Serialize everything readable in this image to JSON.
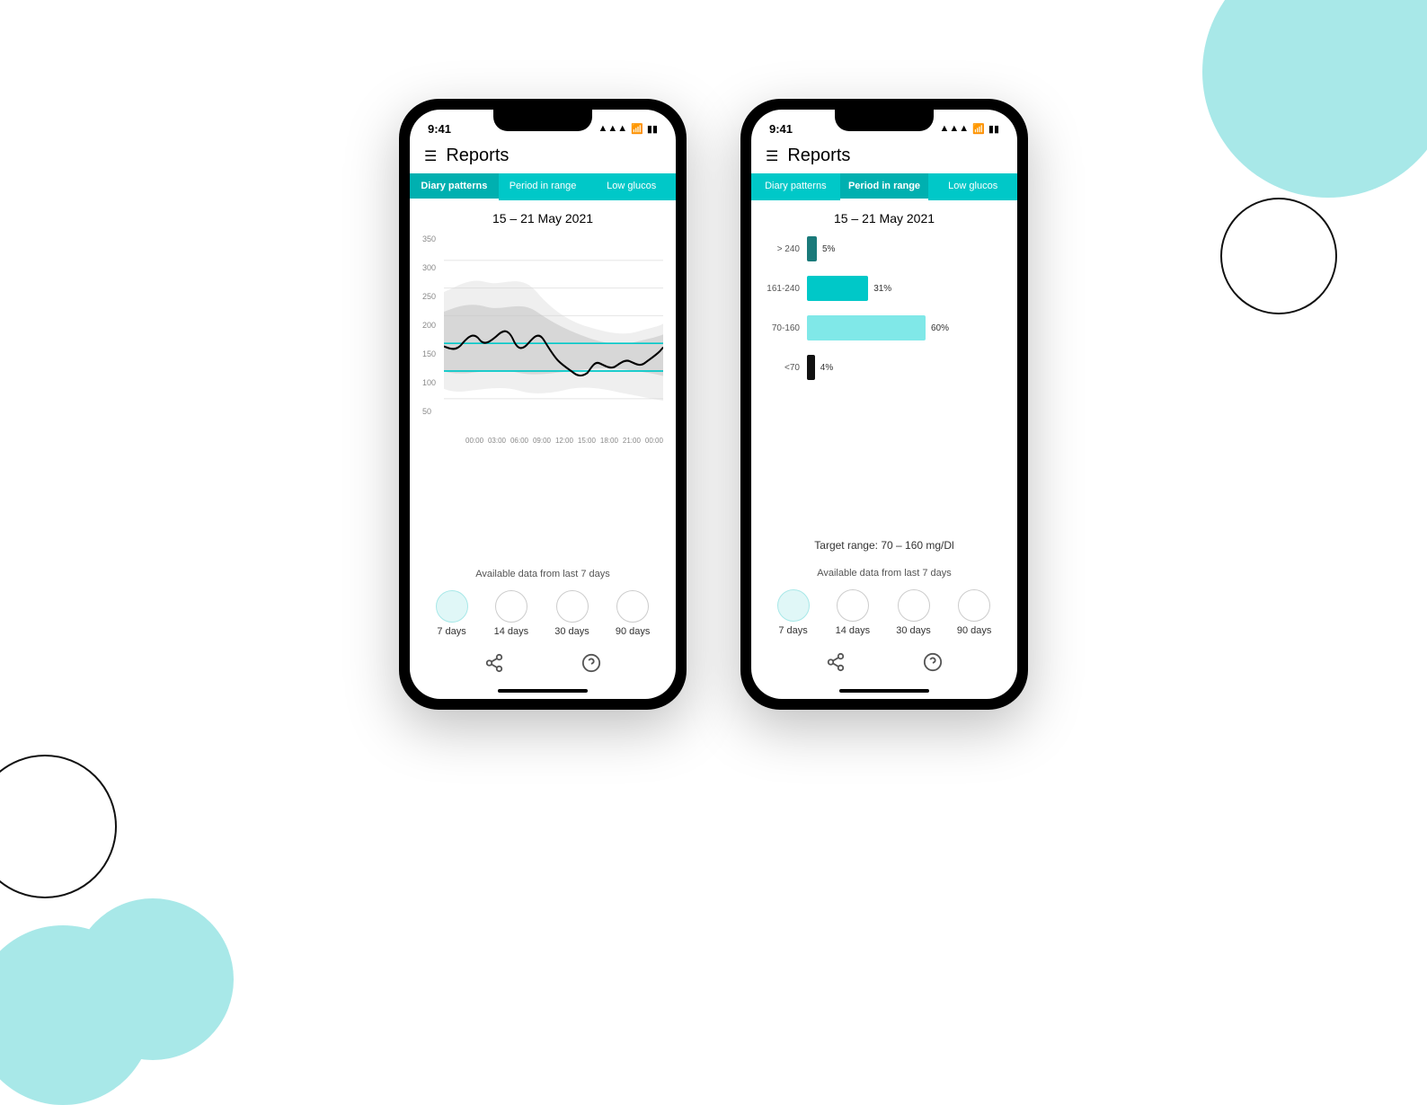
{
  "background": {
    "teal_color": "#a8e8e8",
    "accent_color": "#00c8c8"
  },
  "phone1": {
    "status_bar": {
      "time": "9:41",
      "signal": "▲▲▲",
      "wifi": "wifi",
      "battery": "battery"
    },
    "header": {
      "title": "Reports"
    },
    "tabs": [
      {
        "label": "Diary patterns",
        "active": true
      },
      {
        "label": "Period in range",
        "active": false
      },
      {
        "label": "Low glucos",
        "active": false
      }
    ],
    "date_range": "15 – 21 May 2021",
    "y_axis": [
      "350",
      "300",
      "250",
      "200",
      "150",
      "100",
      "50"
    ],
    "x_axis": [
      "00:00",
      "03:00",
      "06:00",
      "09:00",
      "12:00",
      "15:00",
      "18:00",
      "21:00",
      "00:00"
    ],
    "available_data_label": "Available data from last 7 days",
    "periods": [
      {
        "label": "7 days",
        "selected": true
      },
      {
        "label": "14 days",
        "selected": false
      },
      {
        "label": "30 days",
        "selected": false
      },
      {
        "label": "90 days",
        "selected": false
      }
    ],
    "share_icon": "⋰",
    "help_icon": "?"
  },
  "phone2": {
    "status_bar": {
      "time": "9:41",
      "signal": "▲▲▲",
      "wifi": "wifi",
      "battery": "battery"
    },
    "header": {
      "title": "Reports"
    },
    "tabs": [
      {
        "label": "Diary patterns",
        "active": false
      },
      {
        "label": "Period in range",
        "active": true
      },
      {
        "label": "Low glucos",
        "active": false
      }
    ],
    "date_range": "15 – 21 May 2021",
    "bars": [
      {
        "label": "> 240",
        "pct": "5%",
        "value": 5,
        "color": "#1a7a7a",
        "max": 100
      },
      {
        "label": "161-240",
        "pct": "31%",
        "value": 31,
        "color": "#00c8c8",
        "max": 100
      },
      {
        "label": "70-160",
        "pct": "60%",
        "value": 60,
        "color": "#80e8e8",
        "max": 100
      },
      {
        "label": "<70",
        "pct": "4%",
        "value": 4,
        "color": "#111111",
        "max": 100
      }
    ],
    "target_range": "Target range: 70 – 160 mg/Dl",
    "available_data_label": "Available data from last 7 days",
    "periods": [
      {
        "label": "7 days",
        "selected": true
      },
      {
        "label": "14 days",
        "selected": false
      },
      {
        "label": "30 days",
        "selected": false
      },
      {
        "label": "90 days",
        "selected": false
      }
    ],
    "share_icon": "⋰",
    "help_icon": "?"
  }
}
